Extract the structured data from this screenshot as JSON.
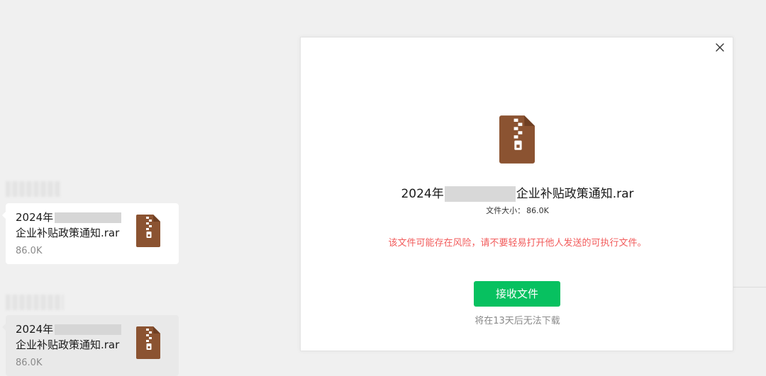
{
  "colors": {
    "page_background": "#f0f0f0",
    "bubble_background": "#ffffff",
    "bubble_hover_background": "#e9e9e9",
    "zip_icon_brown": "#8b5331",
    "warning_red": "#f25c5c",
    "accept_green": "#07c160"
  },
  "chat": {
    "messages": [
      {
        "file_name_line1": "2024年",
        "file_name_line2": "企业补贴政策通知.rar",
        "file_size": "86.0K",
        "icon": "zip-file-icon"
      },
      {
        "file_name_line1": "2024年",
        "file_name_line2": "企业补贴政策通知.rar",
        "file_size": "86.0K",
        "icon": "zip-file-icon"
      }
    ]
  },
  "dialog": {
    "close_icon": "close-icon",
    "file_icon": "zip-file-icon",
    "file_name_prefix": "2024年",
    "file_name_suffix": "企业补贴政策通知.rar",
    "size_label": "文件大小：",
    "size_value": "86.0K",
    "warning": "该文件可能存在风险，请不要轻易打开他人发送的可执行文件。",
    "accept_button": "接收文件",
    "expire_note": "将在13天后无法下载"
  }
}
